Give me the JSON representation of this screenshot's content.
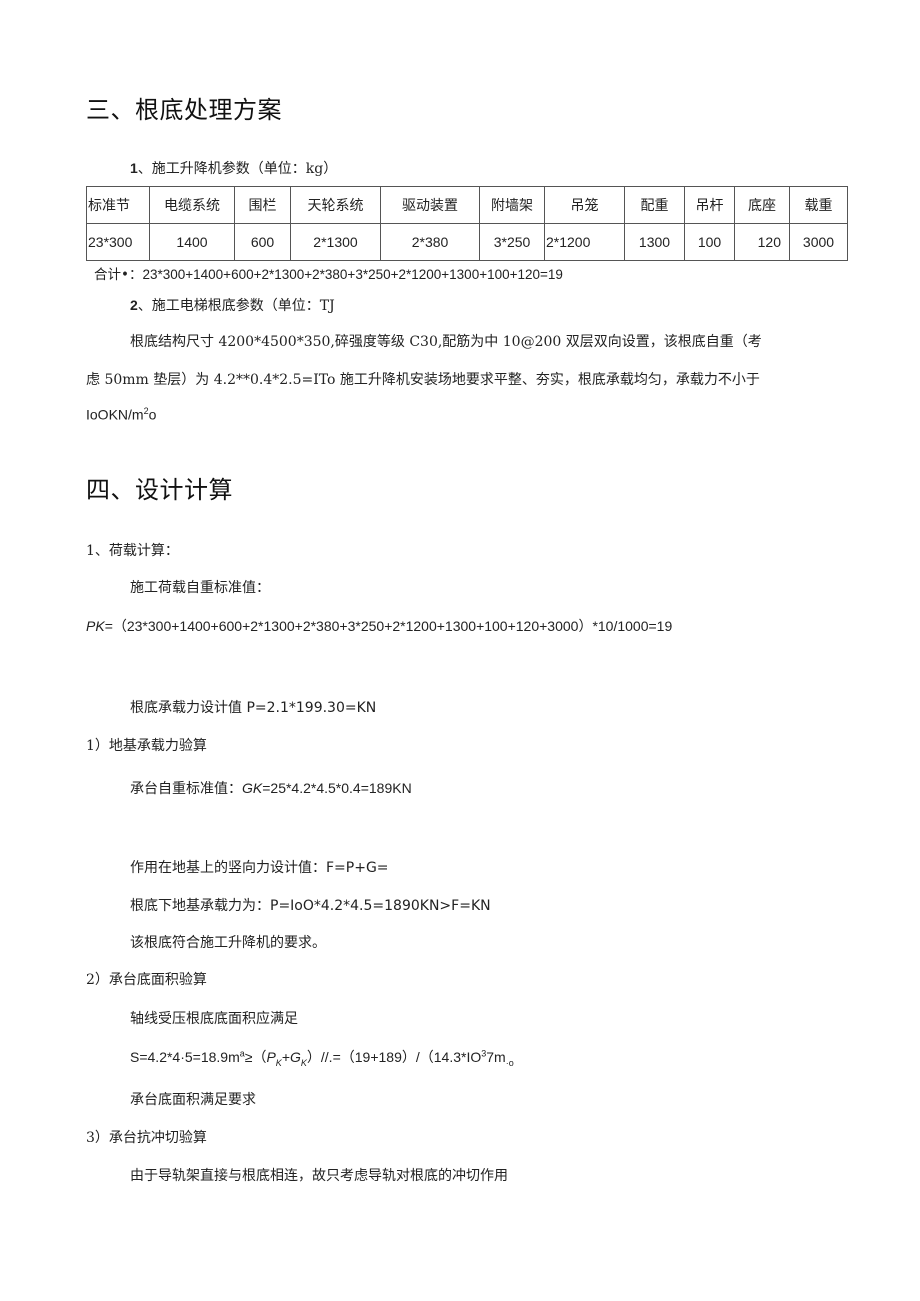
{
  "section3": {
    "title": "三、根底处理方案",
    "item1": {
      "num": "1",
      "label": "、施工升降机参数（单位：kg）"
    },
    "table": {
      "headers": [
        "标准节",
        "电缆系统",
        "围栏",
        "天轮系统",
        "驱动装置",
        "附墙架",
        "吊笼",
        "配重",
        "吊杆",
        "底座",
        "载重"
      ],
      "values": [
        "23*300",
        "1400",
        "600",
        "2*1300",
        "2*380",
        "3*250",
        "2*1200",
        "1300",
        "100",
        "120",
        "3000"
      ]
    },
    "total": {
      "label": "合计•：",
      "expr": "23*300+1400+600+2*1300+2*380+3*250+2*1200+1300+100+120=19"
    },
    "item2": {
      "num": "2",
      "label": "、施工电梯根底参数（单位：TJ"
    },
    "para": {
      "line1": "根底结构尺寸 4200*4500*350,碎强度等级 C30,配筋为中 10@200 双层双向设置，该根底自重（考",
      "line2": "虑 50mm 垫层）为 4.2**0.4*2.5=ITo 施工升降机安装场地要求平整、夯实，根底承载均匀，承载力不小于",
      "line3_pre": "IoOKN/m",
      "line3_sup": "2",
      "line3_post": "o"
    }
  },
  "section4": {
    "title": "四、设计计算",
    "load_calc": {
      "heading": "1、荷载计算：",
      "std_label": "施工荷载自重标准值：",
      "pk_var": "PK",
      "pk_expr": "=（23*300+1400+600+2*1300+2*380+3*250+2*1200+1300+100+120+3000）*10/1000=19",
      "design_value": "根底承载力设计值 P=2.1*199.30=KN"
    },
    "check1": {
      "heading": "1）地基承载力验算",
      "self_weight_label": "承台自重标准值：",
      "gk_var": "GK",
      "gk_expr": "=25*4.2*4.5*0.4=189KN",
      "vertical_force": "作用在地基上的竖向力设计值：F=P+G=",
      "bearing": "根底下地基承载力为：P=IoO*4.2*4.5=1890KN>F=KN",
      "conclusion": "该根底符合施工升降机的要求。"
    },
    "check2": {
      "heading": "2）承台底面积验算",
      "condition": "轴线受压根底底面积应满足",
      "formula_pre": "S=4.2*4·5=18.9m",
      "formula_sup": "a",
      "formula_mid": "≥（",
      "pk": "P",
      "pk_sub": "K",
      "plus": "+",
      "gk": "G",
      "gk_sub": "K",
      "formula_post": "）//.=（19+189）/（14.3*IO",
      "formula_sup2": "3",
      "formula_end": "7m",
      "formula_sub_end": "·o",
      "conclusion": "承台底面积满足要求"
    },
    "check3": {
      "heading": "3）承台抗冲切验算",
      "text": "由于导轨架直接与根底相连，故只考虑导轨对根底的冲切作用"
    }
  }
}
